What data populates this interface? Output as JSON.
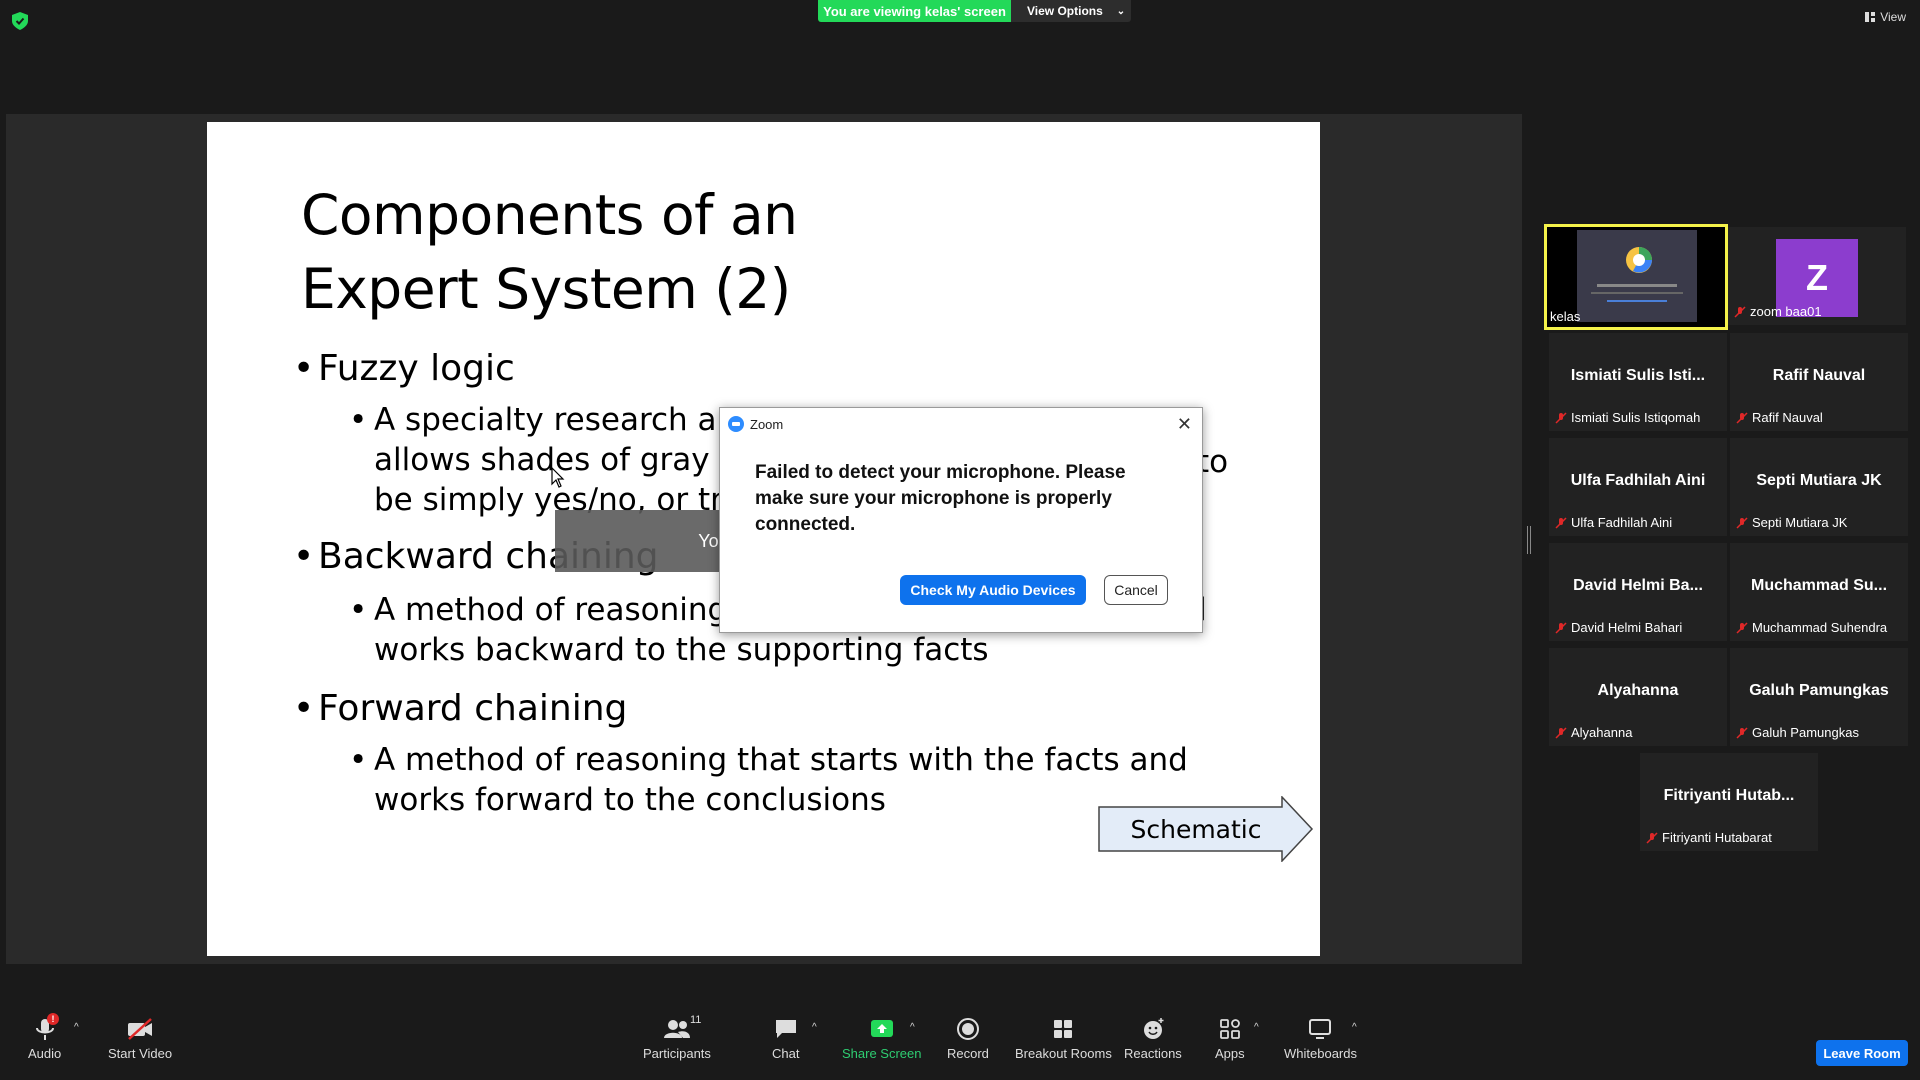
{
  "top_bar": {
    "viewing_banner": "You are viewing kelas' screen",
    "view_options": "View Options",
    "view": "View"
  },
  "slide": {
    "title_line1": "Components of an",
    "title_line2": "Expert System (2)",
    "bullet1": "Fuzzy logic",
    "bullet1_sub": [
      "A specialty research ar",
      "allows shades of gray a",
      "be simply yes/no, or tr"
    ],
    "bullet1_sub_tail": "to",
    "bullet2": "Backward chaining",
    "bullet2_sub": [
      "A method of reasoning",
      "works backward to the supporting facts"
    ],
    "bullet2_sub_tail": "d",
    "bullet3": "Forward chaining",
    "bullet3_sub": [
      "A method of reasoning that starts with the facts and",
      "works forward to the conclusions"
    ],
    "schematic": "Schematic"
  },
  "dialog": {
    "app_name": "Zoom",
    "message": "Failed to detect your microphone. Please make sure your microphone is properly connected.",
    "primary_button": "Check My Audio Devices",
    "cancel_button": "Cancel"
  },
  "toast": "You are now in a Breakout Room",
  "participants": [
    {
      "name": "kelas",
      "label": "kelas"
    },
    {
      "name": "zoom baa01",
      "label": "zoom baa01",
      "initial": "Z"
    },
    {
      "name": "Ismiati Sulis Isti...",
      "label": "Ismiati Sulis Istiqomah"
    },
    {
      "name": "Rafif Nauval",
      "label": "Rafif Nauval"
    },
    {
      "name": "Ulfa Fadhilah Aini",
      "label": "Ulfa Fadhilah Aini"
    },
    {
      "name": "Septi Mutiara JK",
      "label": "Septi Mutiara JK"
    },
    {
      "name": "David Helmi Ba...",
      "label": "David Helmi Bahari"
    },
    {
      "name": "Muchammad Su...",
      "label": "Muchammad Suhendra"
    },
    {
      "name": "Alyahanna",
      "label": "Alyahanna"
    },
    {
      "name": "Galuh Pamungkas",
      "label": "Galuh Pamungkas"
    },
    {
      "name": "Fitriyanti Hutab...",
      "label": "Fitriyanti Hutabarat"
    }
  ],
  "toolbar": {
    "audio": "Audio",
    "audio_badge": "!",
    "start_video": "Start Video",
    "participants": "Participants",
    "participants_count": "11",
    "chat": "Chat",
    "share_screen": "Share Screen",
    "record": "Record",
    "breakout_rooms": "Breakout Rooms",
    "reactions": "Reactions",
    "apps": "Apps",
    "whiteboards": "Whiteboards",
    "leave_room": "Leave Room"
  },
  "colors": {
    "banner_green": "#23d959",
    "zoom_blue": "#0e72ed",
    "active_speaker": "#f4f24a",
    "avatar_purple": "#8c3dce",
    "mic_muted_red": "#e02828"
  }
}
